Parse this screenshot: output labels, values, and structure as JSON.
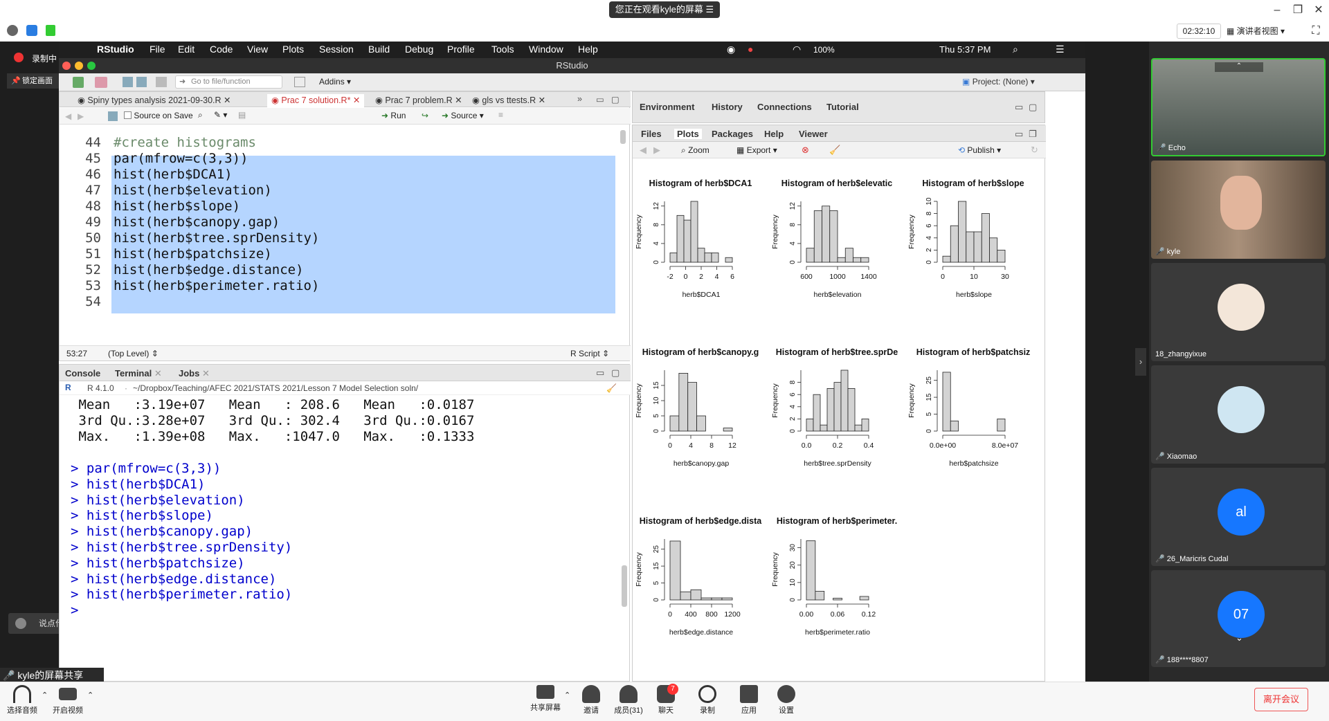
{
  "meeting": {
    "banner": "您正在观看kyle的屏幕",
    "timer": "02:32:10",
    "presenter_view": "演讲者视图",
    "recording": "录制中",
    "lock_screen": "锁定画面",
    "share_label": "kyle的屏幕共享",
    "speak_hint": "说点什么...",
    "leave": "离开会议",
    "chat_badge": "7",
    "taskbar": [
      {
        "label": "选择音频",
        "icon": "headset-icon"
      },
      {
        "label": "开启视频",
        "icon": "camera-off-icon"
      },
      {
        "label": "共享屏幕",
        "icon": "share-screen-icon"
      },
      {
        "label": "邀请",
        "icon": "invite-icon"
      },
      {
        "label": "成员(31)",
        "icon": "members-icon"
      },
      {
        "label": "聊天",
        "icon": "chat-icon"
      },
      {
        "label": "录制",
        "icon": "record-icon"
      },
      {
        "label": "应用",
        "icon": "apps-icon"
      },
      {
        "label": "设置",
        "icon": "settings-icon"
      }
    ],
    "participants": [
      {
        "name": "Echo"
      },
      {
        "name": "kyle"
      },
      {
        "name": "18_zhangyixue"
      },
      {
        "name": "Xiaomao"
      },
      {
        "name": "26_Maricris Cudal",
        "initials": "al"
      },
      {
        "name": "188****8807",
        "initials": "07"
      }
    ]
  },
  "mac_menu": {
    "app": "RStudio",
    "items": [
      "File",
      "Edit",
      "Code",
      "View",
      "Plots",
      "Session",
      "Build",
      "Debug",
      "Profile",
      "Tools",
      "Window",
      "Help"
    ],
    "battery": "100%",
    "clock": "Thu 5:37 PM"
  },
  "rstudio": {
    "window_title": "RStudio",
    "goto_placeholder": "Go to file/function",
    "addins": "Addins",
    "project": "Project: (None)",
    "editor_tabs": [
      "Spiny types analysis 2021-09-30.R",
      "Prac 7 solution.R*",
      "Prac 7 problem.R",
      "gls vs ttests.R"
    ],
    "source_on_save": "Source on Save",
    "run": "Run",
    "source": "Source",
    "lines": [
      {
        "num": "44",
        "text": "#create histograms"
      },
      {
        "num": "45",
        "text": "par(mfrow=c(3,3))"
      },
      {
        "num": "46",
        "text": "hist(herb$DCA1)"
      },
      {
        "num": "47",
        "text": "hist(herb$elevation)"
      },
      {
        "num": "48",
        "text": "hist(herb$slope)"
      },
      {
        "num": "49",
        "text": "hist(herb$canopy.gap)"
      },
      {
        "num": "50",
        "text": "hist(herb$tree.sprDensity)"
      },
      {
        "num": "51",
        "text": "hist(herb$patchsize)"
      },
      {
        "num": "52",
        "text": "hist(herb$edge.distance)"
      },
      {
        "num": "53",
        "text": "hist(herb$perimeter.ratio)"
      },
      {
        "num": "54",
        "text": ""
      }
    ],
    "cursor_pos": "53:27",
    "scope": "(Top Level)",
    "file_type": "R Script",
    "console_tabs": [
      "Console",
      "Terminal",
      "Jobs"
    ],
    "r_version": "R 4.1.0",
    "console_path": "~/Dropbox/Teaching/AFEC 2021/STATS 2021/Lesson 7 Model Selection soln/",
    "console_output": [
      " Mean   :3.19e+07   Mean   : 208.6   Mean   :0.0187",
      " 3rd Qu.:3.28e+07   3rd Qu.: 302.4   3rd Qu.:0.0167",
      " Max.   :1.39e+08   Max.   :1047.0   Max.   :0.1333"
    ],
    "console_cmds": [
      "> par(mfrow=c(3,3))",
      "> hist(herb$DCA1)",
      "> hist(herb$elevation)",
      "> hist(herb$slope)",
      "> hist(herb$canopy.gap)",
      "> hist(herb$tree.sprDensity)",
      "> hist(herb$patchsize)",
      "> hist(herb$edge.distance)",
      "> hist(herb$perimeter.ratio)",
      ">"
    ],
    "env_tabs": [
      "Environment",
      "History",
      "Connections",
      "Tutorial"
    ],
    "files_tabs": [
      "Files",
      "Plots",
      "Packages",
      "Help",
      "Viewer"
    ],
    "plots_toolbar": {
      "zoom": "Zoom",
      "export": "Export",
      "publish": "Publish"
    }
  },
  "chart_data": [
    {
      "type": "bar",
      "title": "Histogram of herb$DCA1",
      "xlabel": "herb$DCA1",
      "ylabel": "Frequency",
      "xticks": [
        "-2",
        "0",
        "2",
        "4",
        "6"
      ],
      "yticks": [
        "0",
        "4",
        "8",
        "12"
      ],
      "ylim": [
        0,
        13
      ],
      "values": [
        2,
        10,
        9,
        13,
        3,
        2,
        2,
        0,
        1
      ]
    },
    {
      "type": "bar",
      "title": "Histogram of herb$elevatic",
      "xlabel": "herb$elevation",
      "ylabel": "Frequency",
      "xticks": [
        "600",
        "1000",
        "1400"
      ],
      "yticks": [
        "0",
        "4",
        "8",
        "12"
      ],
      "ylim": [
        0,
        13
      ],
      "values": [
        3,
        11,
        12,
        11,
        1,
        3,
        1,
        1
      ]
    },
    {
      "type": "bar",
      "title": "Histogram of herb$slope",
      "xlabel": "herb$slope",
      "ylabel": "Frequency",
      "xticks": [
        "0",
        "10",
        "30"
      ],
      "yticks": [
        "0",
        "2",
        "4",
        "6",
        "8",
        "10"
      ],
      "ylim": [
        0,
        10
      ],
      "values": [
        1,
        6,
        10,
        5,
        5,
        8,
        4,
        2
      ]
    },
    {
      "type": "bar",
      "title": "Histogram of herb$canopy.g",
      "xlabel": "herb$canopy.gap",
      "ylabel": "Frequency",
      "xticks": [
        "0",
        "4",
        "8",
        "12"
      ],
      "yticks": [
        "0",
        "5",
        "10",
        "15"
      ],
      "ylim": [
        0,
        20
      ],
      "values": [
        5,
        19,
        16,
        5,
        0,
        0,
        1
      ]
    },
    {
      "type": "bar",
      "title": "Histogram of herb$tree.sprDe",
      "xlabel": "herb$tree.sprDensity",
      "ylabel": "Frequency",
      "xticks": [
        "0.0",
        "0.2",
        "0.4"
      ],
      "yticks": [
        "0",
        "2",
        "4",
        "6",
        "8"
      ],
      "ylim": [
        0,
        10
      ],
      "values": [
        2,
        6,
        1,
        7,
        8,
        10,
        7,
        1,
        2
      ]
    },
    {
      "type": "bar",
      "title": "Histogram of herb$patchsiz",
      "xlabel": "herb$patchsize",
      "ylabel": "Frequency",
      "xticks": [
        "0.0e+00",
        "8.0e+07"
      ],
      "yticks": [
        "0",
        "5",
        "15",
        "25"
      ],
      "ylim": [
        0,
        30
      ],
      "values": [
        29,
        5,
        0,
        0,
        0,
        0,
        0,
        6
      ]
    },
    {
      "type": "bar",
      "title": "Histogram of herb$edge.dista",
      "xlabel": "herb$edge.distance",
      "ylabel": "Frequency",
      "xticks": [
        "0",
        "400",
        "800",
        "1200"
      ],
      "yticks": [
        "0",
        "5",
        "15",
        "25"
      ],
      "ylim": [
        0,
        30
      ],
      "values": [
        29,
        4,
        5,
        1,
        1,
        1
      ]
    },
    {
      "type": "bar",
      "title": "Histogram of herb$perimeter.",
      "xlabel": "herb$perimeter.ratio",
      "ylabel": "Frequency",
      "xticks": [
        "0.00",
        "0.06",
        "0.12"
      ],
      "yticks": [
        "0",
        "10",
        "20",
        "30"
      ],
      "ylim": [
        0,
        35
      ],
      "values": [
        34,
        5,
        0,
        1,
        0,
        0,
        2
      ]
    }
  ]
}
